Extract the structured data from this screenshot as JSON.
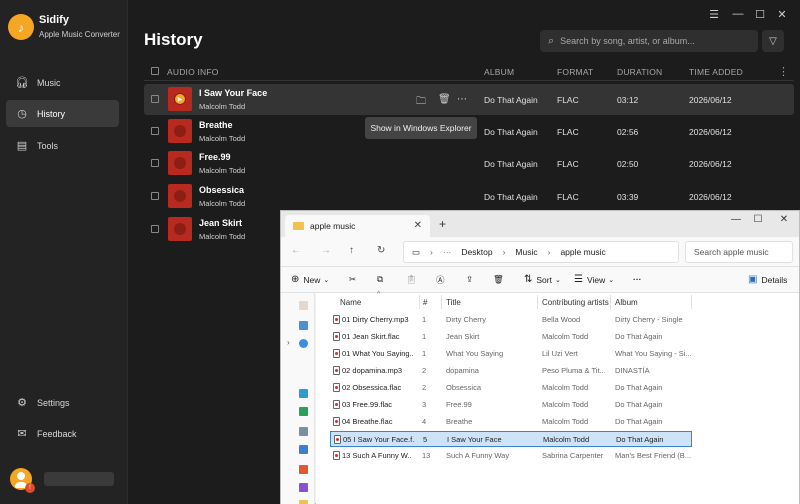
{
  "app": {
    "name": "Sidify",
    "subtitle": "Apple Music Converter"
  },
  "sidebar": {
    "items": [
      {
        "label": "Music",
        "icon": "headphones-icon"
      },
      {
        "label": "History",
        "icon": "clock-icon"
      },
      {
        "label": "Tools",
        "icon": "toolbox-icon"
      }
    ],
    "bottom": [
      {
        "label": "Settings",
        "icon": "gear-icon"
      },
      {
        "label": "Feedback",
        "icon": "mail-icon"
      }
    ]
  },
  "page": {
    "title": "History"
  },
  "search": {
    "placeholder": "Search by song, artist, or album..."
  },
  "table": {
    "columns": [
      "AUDIO INFO",
      "ALBUM",
      "FORMAT",
      "DURATION",
      "TIME ADDED"
    ],
    "rows": [
      {
        "title": "I Saw Your Face",
        "artist": "Malcolm Todd",
        "album": "Do That Again",
        "format": "FLAC",
        "duration": "03:12",
        "added": "2026/06/12"
      },
      {
        "title": "Breathe",
        "artist": "Malcolm Todd",
        "album": "Do That Again",
        "format": "FLAC",
        "duration": "02:56",
        "added": "2026/06/12"
      },
      {
        "title": "Free.99",
        "artist": "Malcolm Todd",
        "album": "Do That Again",
        "format": "FLAC",
        "duration": "02:50",
        "added": "2026/06/12"
      },
      {
        "title": "Obsessica",
        "artist": "Malcolm Todd",
        "album": "Do That Again",
        "format": "FLAC",
        "duration": "03:39",
        "added": "2026/06/12"
      },
      {
        "title": "Jean Skirt",
        "artist": "Malcolm Todd",
        "album": "Do That Again",
        "format": "FLAC",
        "duration": "",
        "added": ""
      }
    ]
  },
  "tooltip": "Show in Windows Explorer",
  "explorer": {
    "tab_title": "apple music",
    "path": [
      "Desktop",
      "Music",
      "apple music"
    ],
    "search_placeholder": "Search apple music",
    "commands": {
      "new": "New",
      "sort": "Sort",
      "view": "View",
      "details": "Details"
    },
    "columns": [
      "Name",
      "#",
      "Title",
      "Contributing artists",
      "Album"
    ],
    "files": [
      {
        "name": "01 Dirty Cherry.mp3",
        "num": "1",
        "title": "Dirty Cherry",
        "artist": "Bella Wood",
        "album": "Dirty Cherry - Single"
      },
      {
        "name": "01 Jean Skirt.flac",
        "num": "1",
        "title": "Jean Skirt",
        "artist": "Malcolm Todd",
        "album": "Do That Again"
      },
      {
        "name": "01 What You Saying...",
        "num": "1",
        "title": "What You Saying",
        "artist": "Lil Uzi Vert",
        "album": "What You Saying - Si..."
      },
      {
        "name": "02 dopamina.mp3",
        "num": "2",
        "title": "dopamina",
        "artist": "Peso Pluma & Tit...",
        "album": "DINASTÍA"
      },
      {
        "name": "02 Obsessica.flac",
        "num": "2",
        "title": "Obsessica",
        "artist": "Malcolm Todd",
        "album": "Do That Again"
      },
      {
        "name": "03 Free.99.flac",
        "num": "3",
        "title": "Free.99",
        "artist": "Malcolm Todd",
        "album": "Do That Again"
      },
      {
        "name": "04 Breathe.flac",
        "num": "4",
        "title": "Breathe",
        "artist": "Malcolm Todd",
        "album": "Do That Again"
      },
      {
        "name": "05 I Saw Your Face.f...",
        "num": "5",
        "title": "I Saw Your Face",
        "artist": "Malcolm Todd",
        "album": "Do That Again"
      },
      {
        "name": "13 Such A Funny W...",
        "num": "13",
        "title": "Such A Funny Way",
        "artist": "Sabrina Carpenter",
        "album": "Man's Best Friend (B..."
      }
    ]
  },
  "colors": {
    "accent": "#f5a623",
    "album_art": "#b8291f",
    "selection": "#cfe3f8"
  }
}
